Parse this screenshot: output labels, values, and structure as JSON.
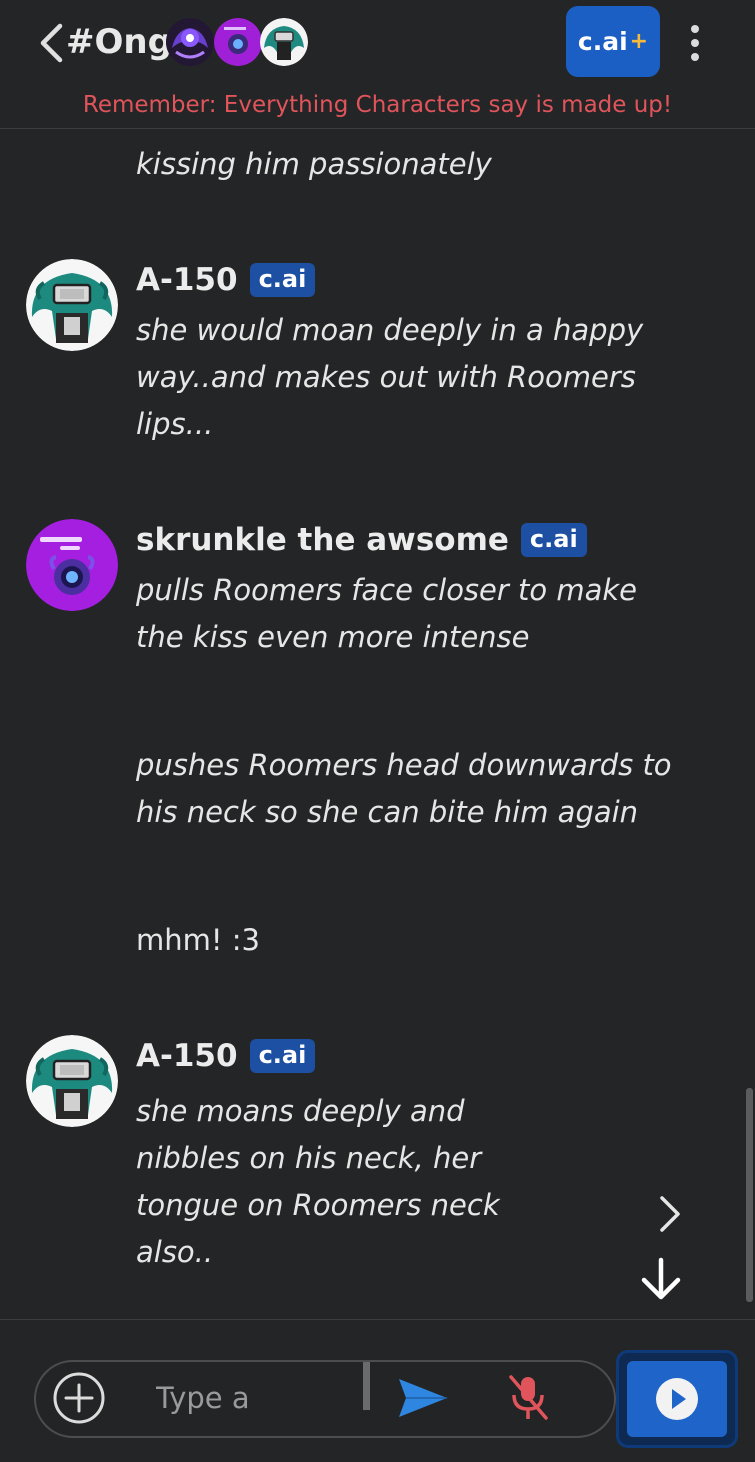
{
  "header": {
    "back_icon": "chevron-left-icon",
    "title": "#Ong",
    "plus_button": {
      "text": "c.ai",
      "plus": "+"
    },
    "menu_icon": "vertical-dots-icon",
    "reminder": "Remember: Everything Characters say is made up!"
  },
  "messages": [
    {
      "text": "kissing him passionately"
    },
    {
      "name": "A-150",
      "badge": "c.ai",
      "text": "she would moan deeply in a happy\nway..and makes out with Roomers\nlips..."
    },
    {
      "name": "skrunkle the awsome",
      "badge": "c.ai",
      "text": "pulls Roomers face closer to make\nthe kiss even more intense"
    },
    {
      "text": "pushes Roomers head downwards to\nhis neck so she can bite him again"
    },
    {
      "text": "mhm! :3"
    },
    {
      "name": "A-150",
      "badge": "c.ai",
      "text": "she moans deeply and\nnibbles on his neck, her\ntongue on Roomers neck\nalso.."
    }
  ],
  "composer": {
    "placeholder": "Type a",
    "add_icon": "plus-circle-icon",
    "send_icon": "send-icon",
    "mic_icon": "mic-off-icon",
    "play_icon": "play-icon"
  },
  "colors": {
    "background": "#242526",
    "accent": "#1f64c8",
    "badge": "#1d4fa3",
    "warning": "#e0555b",
    "send": "#2f86e0",
    "mic_off": "#e0555b"
  }
}
